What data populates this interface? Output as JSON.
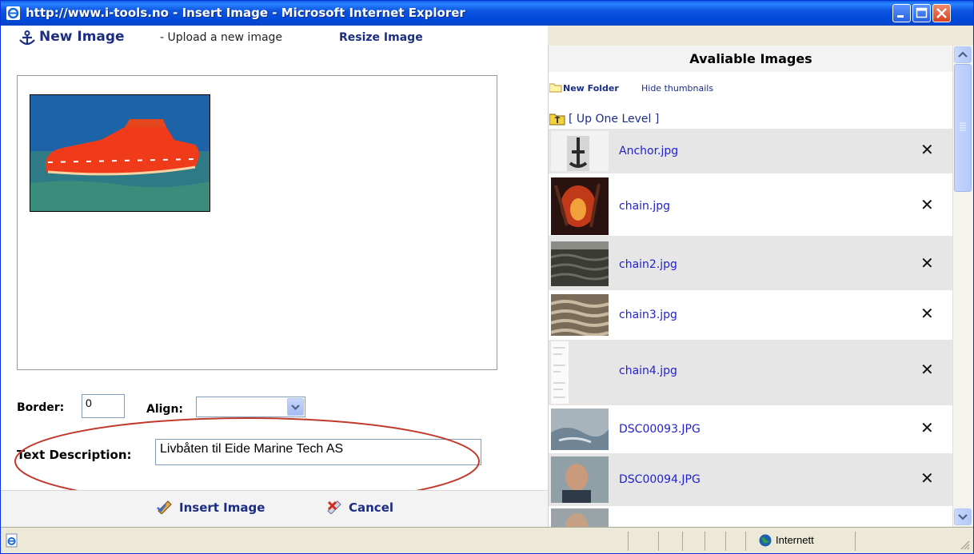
{
  "window": {
    "title": "http://www.i-tools.no - Insert Image - Microsoft Internet Explorer"
  },
  "upload": {
    "new_image_label": "New Image",
    "separator_text": "- Upload a new image",
    "resize_label": "Resize Image"
  },
  "form": {
    "border_label": "Border:",
    "border_value": "0",
    "align_label": "Align:",
    "align_value": "",
    "description_label": "Text Description:",
    "description_value": "Livbåten til Eide Marine Tech AS"
  },
  "buttons": {
    "insert": "Insert Image",
    "cancel": "Cancel"
  },
  "browser": {
    "title": "Avaliable Images",
    "new_folder": "New Folder",
    "hide_thumbnails": "Hide thumbnails",
    "up_level": "[ Up One Level ]",
    "files": [
      {
        "name": "Anchor.jpg"
      },
      {
        "name": "chain.jpg"
      },
      {
        "name": "chain2.jpg"
      },
      {
        "name": "chain3.jpg"
      },
      {
        "name": "chain4.jpg"
      },
      {
        "name": "DSC00093.JPG"
      },
      {
        "name": "DSC00094.JPG"
      }
    ],
    "delete_glyph": "✕"
  },
  "statusbar": {
    "zone": "Internett"
  }
}
